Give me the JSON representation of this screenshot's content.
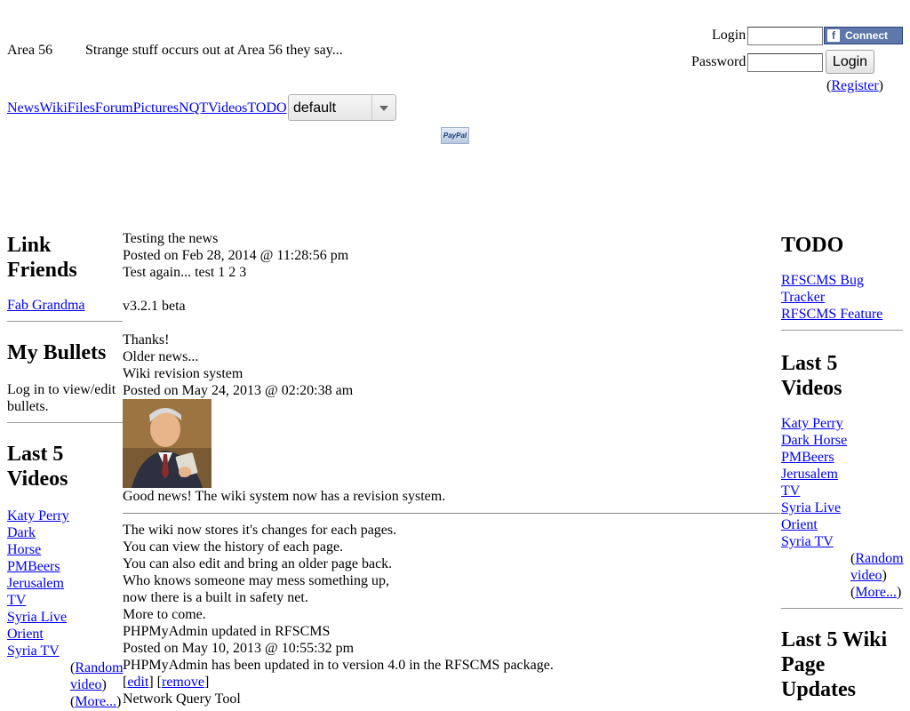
{
  "header": {
    "site_name": "Area 56",
    "tagline": "Strange stuff occurs out at Area 56 they say...",
    "login_label": "Login",
    "password_label": "Password",
    "login_value": "",
    "password_value": "",
    "fb_connect_label": "Connect",
    "login_button": "Login",
    "register_open": "(",
    "register_link": "Register",
    "register_close": ")"
  },
  "nav": {
    "items": [
      "News",
      "Wiki",
      "Files",
      "Forum",
      "Pictures",
      "NQT",
      "Videos",
      "TODO"
    ],
    "theme_select": "default"
  },
  "paypal": {
    "label": "PayPal"
  },
  "left": {
    "link_friends_title_1": "Link",
    "link_friends_title_2": "Friends",
    "link_friends": [
      "Fab Grandma"
    ],
    "bullets_title": "My Bullets",
    "bullets_text_1": "Log in to view/edit",
    "bullets_text_2": "bullets.",
    "videos_title_1": "Last 5",
    "videos_title_2": "Videos",
    "videos": [
      "Katy Perry",
      "Dark",
      "Horse",
      "PMBeers",
      "Jerusalem",
      "TV",
      "Syria Live",
      "Orient",
      "Syria TV"
    ],
    "random_open": "(",
    "random_link_1": "Random",
    "random_link_2": "video",
    "random_close": ")",
    "more_open": "(",
    "more_link": "More...",
    "more_close": ")"
  },
  "main": {
    "news1_title": "Testing the news",
    "news1_posted": "Posted on Feb 28, 2014 @ 11:28:56 pm",
    "news1_body": "Test again... test 1 2 3",
    "news1_version": "v3.2.1 beta",
    "news1_thanks": "Thanks!",
    "older_news": "Older news...",
    "news2_title": "Wiki revision system",
    "news2_posted": "Posted on May 24, 2013 @ 02:20:38 am",
    "news2_lead": "Good news! The wiki system now has a revision system.",
    "news2_lines": [
      "The wiki now stores it's changes for each pages.",
      "You can view the history of each page.",
      "You can also edit and bring an older page back.",
      "Who knows someone may mess something up,",
      "now there is a built in safety net.",
      "More to come."
    ],
    "news3_title": "PHPMyAdmin updated in RFSCMS",
    "news3_posted": "Posted on May 10, 2013 @ 10:55:32 pm",
    "news3_body": "PHPMyAdmin has been updated in to version 4.0 in the RFSCMS package.",
    "edit_link": "edit",
    "remove_link": "remove",
    "news4_title": "Network Query Tool"
  },
  "right": {
    "todo_title": "TODO",
    "todo_links": [
      "RFSCMS Bug",
      "Tracker",
      "RFSCMS Feature"
    ],
    "videos_title_1": "Last 5",
    "videos_title_2": "Videos",
    "videos": [
      "Katy Perry",
      "Dark Horse",
      "PMBeers",
      "Jerusalem",
      "TV",
      "Syria Live",
      "Orient",
      "Syria TV"
    ],
    "random_open": "(",
    "random_link_1": "Random",
    "random_link_2": "video",
    "random_close": ")",
    "more_open": "(",
    "more_link": "More...",
    "more_close": ")",
    "wiki_title_1": "Last 5 Wiki",
    "wiki_title_2": "Page",
    "wiki_title_3": "Updates"
  }
}
